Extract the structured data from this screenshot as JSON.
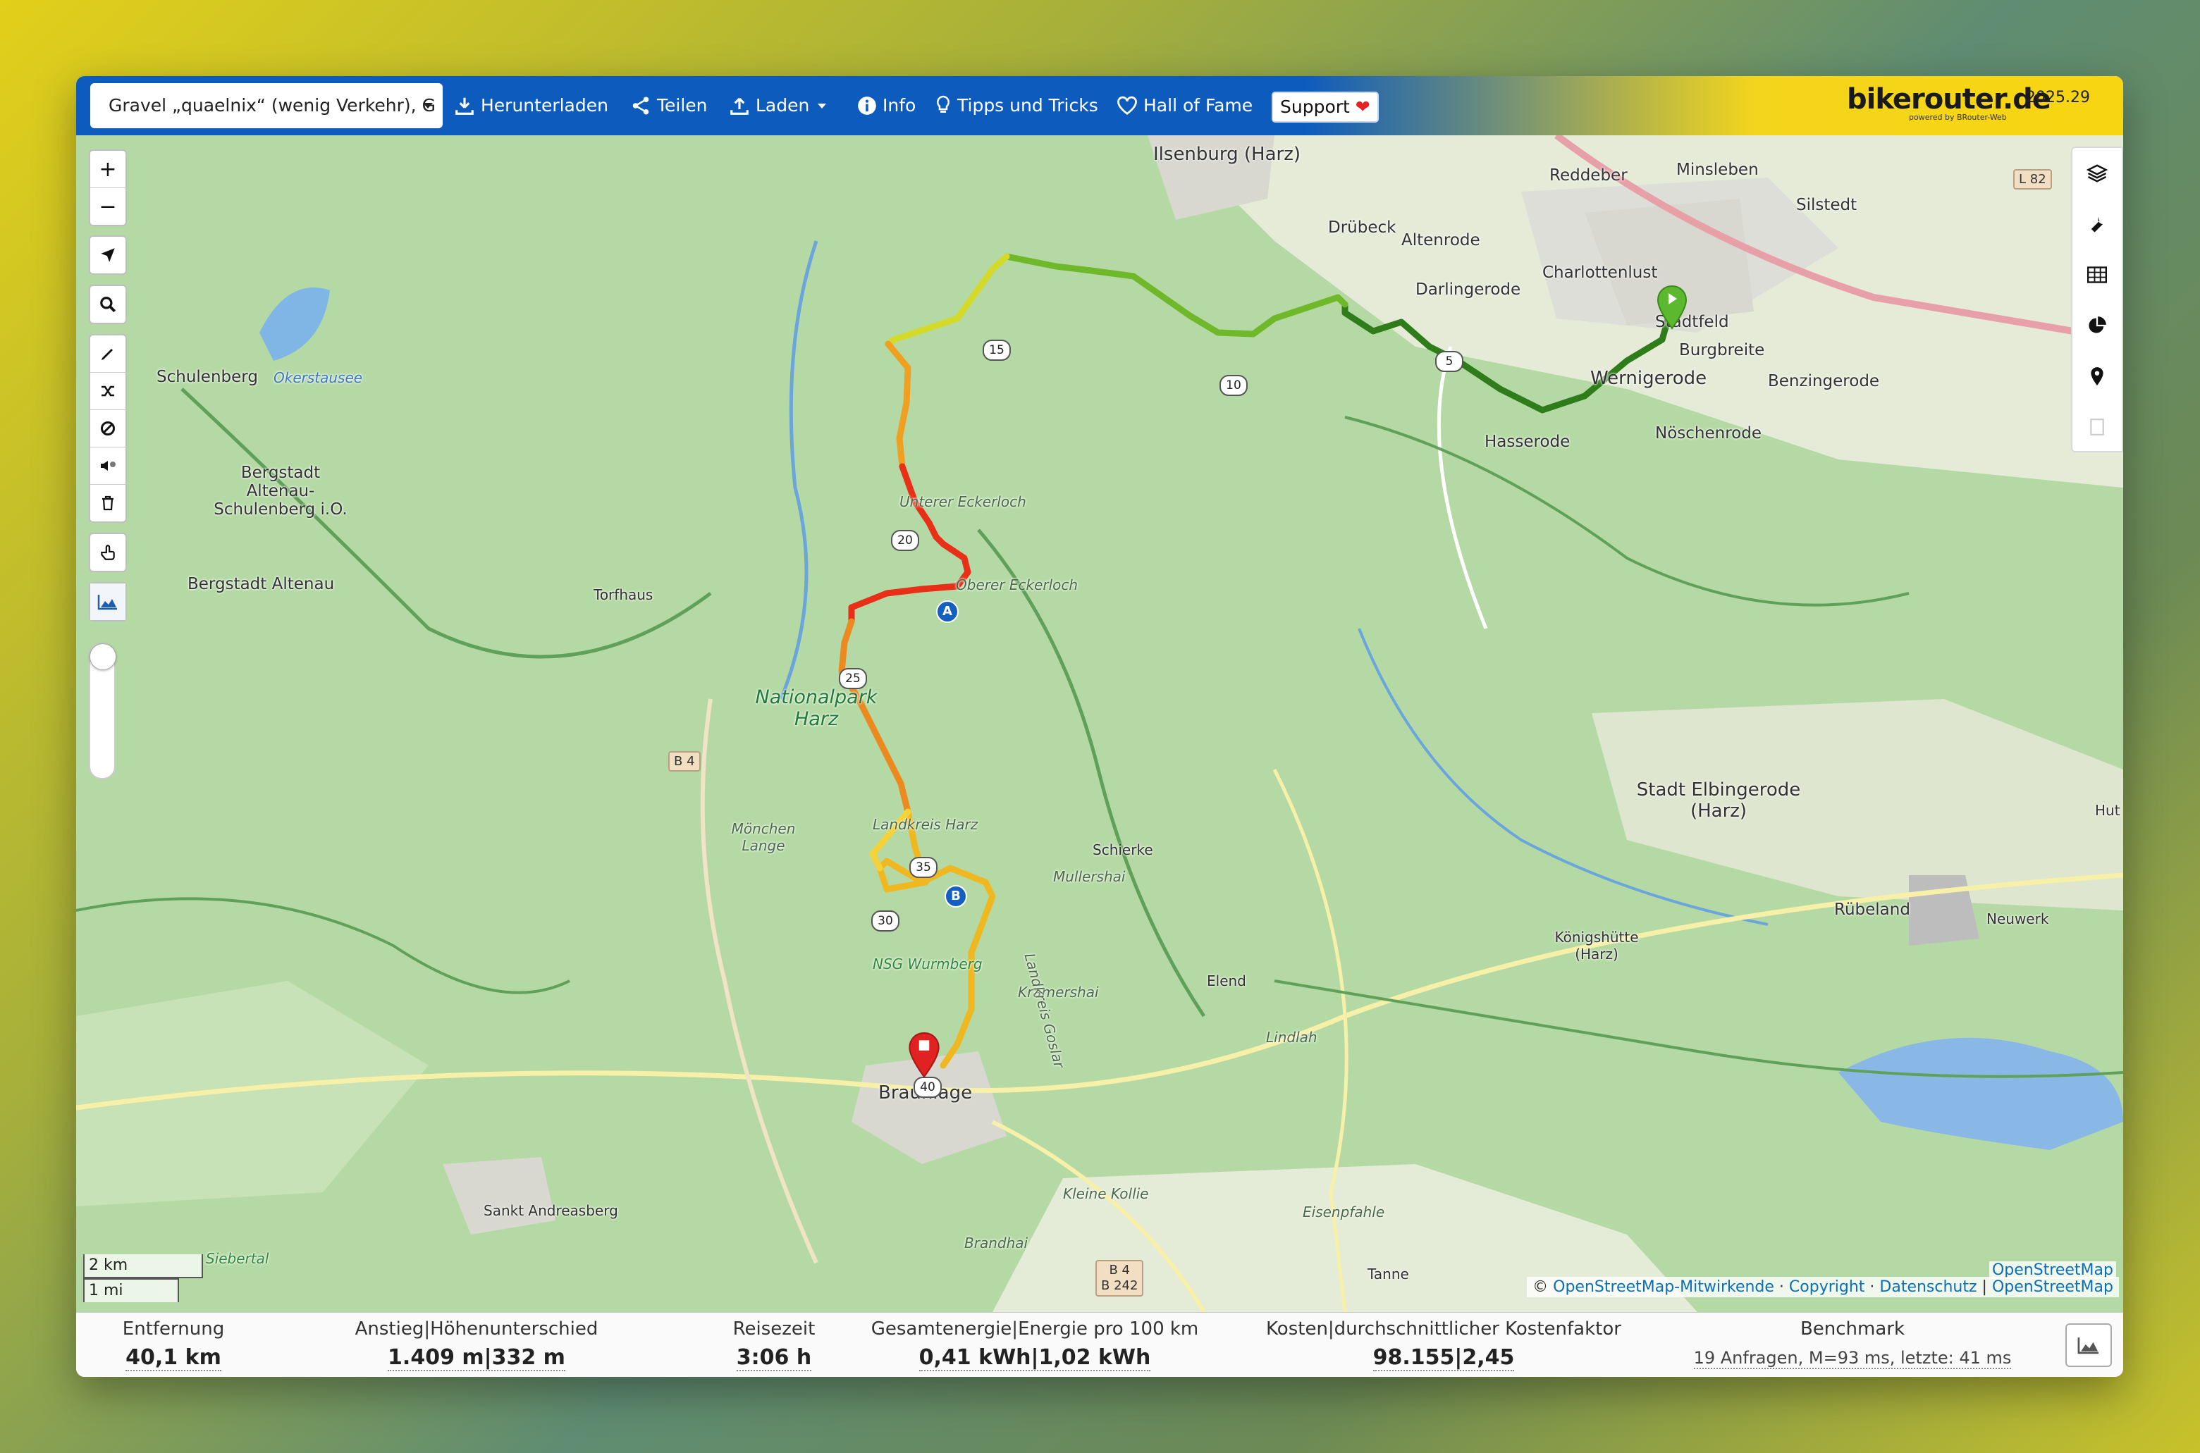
{
  "toolbar": {
    "profile": "Gravel „quaelnix“ (wenig Verkehr), G",
    "download": "Herunterladen",
    "share": "Teilen",
    "load": "Laden",
    "info": "Info",
    "tips": "Tipps und Tricks",
    "hall_of_fame": "Hall of Fame",
    "support": "Support",
    "brand": "bikerouter.de",
    "brand_sub": "powered by BRouter-Web",
    "version": "2025.29"
  },
  "map": {
    "places": {
      "ilsenburg": "Ilsenburg (Harz)",
      "reddeber": "Reddeber",
      "minsleben": "Minsleben",
      "silstedt": "Silstedt",
      "l82": "L 82",
      "druebeck": "Drübeck",
      "altenrode": "Altenrode",
      "charlottenlust": "Charlottenlust",
      "darlingerode": "Darlingerode",
      "stadtfeld": "Stadtfeld",
      "burgbreite": "Burgbreite",
      "wernigerode": "Wernigerode",
      "benzingerode": "Benzingerode",
      "hasserode": "Hasserode",
      "noeschenrode": "Nöschenrode",
      "schulenberg": "Schulenberg",
      "okerstausee": "Okerstausee",
      "altenau_schulenberg": "Bergstadt Altenau-Schulenberg i.O.",
      "altenau": "Bergstadt Altenau",
      "torfhaus": "Torfhaus",
      "unterer_eckerlochstieg": "Unterer Eckerloch",
      "oberer_eckerloch": "Oberer Eckerloch",
      "nationalpark": "Nationalpark Harz",
      "b4": "B 4",
      "moenchen_lange": "Mönchen Lange",
      "schierke": "Schierke",
      "mullershai": "Mullershai",
      "stadt_elbingerode": "Stadt Elbingerode (Harz)",
      "hut": "Hut",
      "ruebeland": "Rübeland",
      "neuwerk": "Neuwerk",
      "koenigshuette": "Königshütte (Harz)",
      "elend": "Elend",
      "kramershai": "Kramershai",
      "nsg_wurmberg": "NSG Wurmberg",
      "lindlah": "Lindlah",
      "braunlage": "Braunlage",
      "sankt_andreasberg": "Sankt Andreasberg",
      "siebertal": "Siebertal",
      "kleine_kollie": "Kleine Kollie",
      "brandhai": "Brandhai",
      "eisenpfahle": "Eisenpfahle",
      "tanne": "Tanne",
      "b4_b242_a": "B 4",
      "b4_b242_b": "B 242",
      "landkreis_harz": "Landkreis Harz",
      "landkreis_goslar": "Landkreis Goslar"
    },
    "km_markers": [
      "5",
      "10",
      "15",
      "20",
      "25",
      "30",
      "35",
      "40"
    ],
    "waypoints": {
      "a": "A",
      "b": "B"
    },
    "scale": {
      "km": "2 km",
      "mi": "1 mi"
    },
    "attribution": {
      "prefix": "©",
      "contributors": "OpenStreetMap-Mitwirkende",
      "copyright": "Copyright",
      "privacy": "Datenschutz",
      "osm": "OpenStreetMap",
      "layer": "OpenStreetMap"
    },
    "route_colors": {
      "start": "#2e7d1a",
      "mid": "#c8d42a",
      "high": "#e8261a",
      "low": "#f0b020"
    }
  },
  "stats": {
    "distance": {
      "label": "Entfernung",
      "value": "40,1 km"
    },
    "ascent": {
      "label": "Anstieg|Höhenunterschied",
      "value": "1.409 m|332 m"
    },
    "time": {
      "label": "Reisezeit",
      "value": "3:06 h"
    },
    "energy": {
      "label": "Gesamtenergie|Energie pro 100 km",
      "value": "0,41 kWh|1,02 kWh"
    },
    "cost": {
      "label": "Kosten|durchschnittlicher Kostenfaktor",
      "value": "98.155|2,45"
    },
    "benchmark": {
      "label": "Benchmark",
      "value": "19 Anfragen, M=93 ms, letzte: 41 ms"
    }
  }
}
